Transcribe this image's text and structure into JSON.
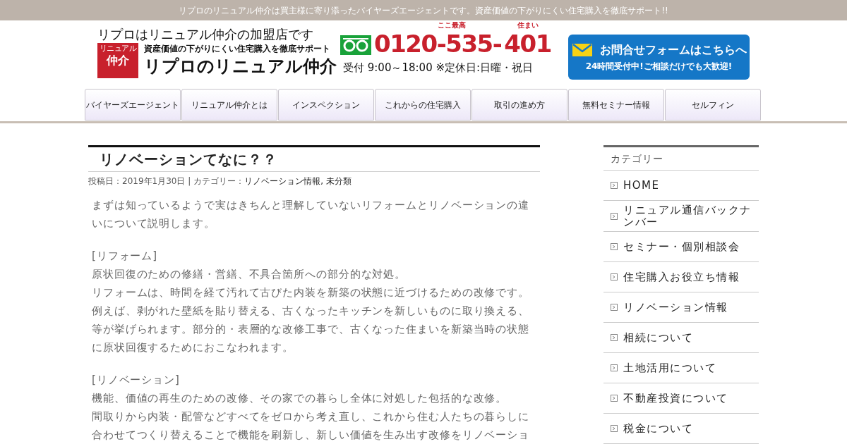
{
  "top_bar": {
    "text": "リプロのリニュアル仲介は買主様に寄り添ったバイヤーズエージェントです。資産価値の下がりにくい住宅購入を徹底サポート!!"
  },
  "header": {
    "tagline": "リプロはリニュアル仲介の加盟店です",
    "logo": {
      "top": "リニュアル",
      "main": "仲介"
    },
    "subtitle": "資産価値の下がりにくい住宅購入を徹底サポート",
    "site_name": "リプロのリニュアル仲介",
    "phone": {
      "number_a": "0120-535-",
      "number_b": "401",
      "note_a": "ここ最高",
      "note_b": "住まい",
      "hours": "受付 9:00～18:00 ※定休日:日曜・祝日"
    },
    "contact_button": {
      "title": "お問合せフォームはこちらへ",
      "subtitle": "24時間受付中!ご相談だけでも大歓迎!"
    }
  },
  "nav": [
    "バイヤーズエージェント",
    "リニュアル仲介とは",
    "インスペクション",
    "これからの住宅購入",
    "取引の進め方",
    "無料セミナー情報",
    "セルフィン"
  ],
  "article": {
    "title": "リノベーションてなに？？",
    "meta_prefix": "投稿日：2019年1月30日 | カテゴリー：",
    "categories": [
      "リノベーション情報",
      "未分類"
    ],
    "category_separator": ",",
    "paragraphs": [
      [
        "まずは知っているようで実はきちんと理解していないリフォームとリノベーションの違いについて説明します。"
      ],
      [
        "[リフォーム]",
        "原状回復のための修繕・営繕、不具合箇所への部分的な対処。",
        "リフォームは、時間を経て汚れて古びた内装を新築の状態に近づけるための改修です。",
        "例えば、剥がれた壁紙を貼り替える、古くなったキッチンを新しいものに取り換える、等が挙げられます。部分的・表層的な改修工事で、古くなった住まいを新築当時の状態に原状回復するためにおこなわれます。"
      ],
      [
        "[リノベーション]",
        "機能、価値の再生のための改修、その家での暮らし全体に対処した包括的な改修。",
        "間取りから内装・配管などすべてをゼロから考え直し、これから住む人たちの暮らしに合わせてつくり替えることで機能を刷新し、新しい価値を生み出す改修をリノベーショ"
      ]
    ]
  },
  "sidebar": {
    "title": "カテゴリー",
    "items": [
      "HOME",
      "リニュアル通信バックナンバー",
      "セミナー・個別相談会",
      "住宅購入お役立ち情報",
      "リノベーション情報",
      "相続について",
      "土地活用について",
      "不動産投資について",
      "税金について"
    ]
  }
}
